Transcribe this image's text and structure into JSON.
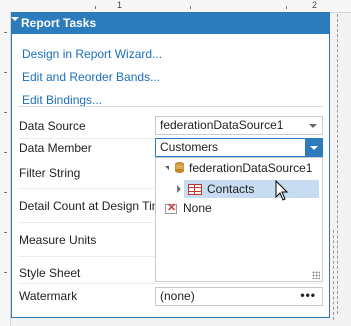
{
  "ruler": {
    "marks": [
      "1",
      "2"
    ]
  },
  "panel": {
    "title": "Report Tasks",
    "links": [
      "Design in Report Wizard...",
      "Edit and Reorder Bands...",
      "Edit Bindings..."
    ],
    "fields": {
      "data_source": {
        "label": "Data Source",
        "value": "federationDataSource1"
      },
      "data_member": {
        "label": "Data Member",
        "value": "Customers"
      },
      "filter_string": {
        "label": "Filter String"
      },
      "detail_count": {
        "label": "Detail Count at Design Time"
      },
      "measure_units": {
        "label": "Measure Units"
      },
      "style_sheet": {
        "label": "Style Sheet"
      },
      "watermark": {
        "label": "Watermark",
        "value": "(none)",
        "button": "•••"
      }
    }
  },
  "dropdown": {
    "root": "federationDataSource1",
    "child": "Contacts",
    "none": "None"
  },
  "colors": {
    "accent": "#2b7bbd",
    "link": "#1a6fbd",
    "selection": "#c7dcf0"
  }
}
